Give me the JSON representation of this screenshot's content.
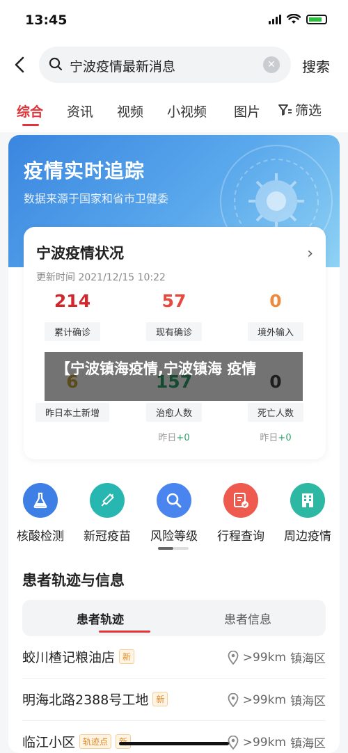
{
  "status_bar": {
    "time": "13:45"
  },
  "search": {
    "query": "宁波疫情最新消息",
    "button": "搜索"
  },
  "tabs": [
    {
      "label": "综合",
      "active": true
    },
    {
      "label": "资讯"
    },
    {
      "label": "视频"
    },
    {
      "label": "小视频"
    },
    {
      "label": "图片"
    }
  ],
  "filter_label": "筛选",
  "hero": {
    "title": "疫情实时追踪",
    "subtitle": "数据来源于国家和省市卫健委"
  },
  "stats": {
    "title": "宁波疫情状况",
    "updated": "更新时间 2021/12/15 10:22",
    "items": [
      {
        "value": "214",
        "label": "累计确诊",
        "color": "#d0262c"
      },
      {
        "value": "57",
        "label": "现有确诊",
        "color": "#e64a3f"
      },
      {
        "value": "0",
        "label": "境外输入",
        "color": "#ef8a3c"
      },
      {
        "value": "6",
        "label": "昨日本土新增",
        "color": "#c9a43a"
      },
      {
        "value": "157",
        "label": "治愈人数",
        "color": "#2fa36a",
        "sub_prefix": "昨日",
        "sub_value": "+0"
      },
      {
        "value": "0",
        "label": "死亡人数",
        "color": "#444444",
        "sub_prefix": "昨日",
        "sub_value": "+0"
      }
    ]
  },
  "banner_text": "【宁波镇海疫情,宁波镇海 疫情",
  "services": [
    {
      "label": "核酸检测",
      "icon": "flask-icon",
      "color": "#3e7fe6"
    },
    {
      "label": "新冠疫苗",
      "icon": "syringe-icon",
      "color": "#27b7b0"
    },
    {
      "label": "风险等级",
      "icon": "magnifier-icon",
      "color": "#4a84ef"
    },
    {
      "label": "行程查询",
      "icon": "itinerary-icon",
      "color": "#ef5a4f"
    },
    {
      "label": "周边疫情",
      "icon": "building-icon",
      "color": "#2db8a4"
    }
  ],
  "patient": {
    "title": "患者轨迹与信息",
    "seg_track": "患者轨迹",
    "seg_info": "患者信息",
    "locations": [
      {
        "name": "蛟川楂记粮油店",
        "tags": [
          "新"
        ],
        "distance": ">99km",
        "district": "镇海区"
      },
      {
        "name": "明海北路2388号工地",
        "tags": [
          "新"
        ],
        "distance": ">99km",
        "district": "镇海区"
      },
      {
        "name": "临江小区",
        "tags": [
          "轨迹点",
          "新"
        ],
        "distance": ">99km",
        "district": "镇海区"
      }
    ]
  }
}
